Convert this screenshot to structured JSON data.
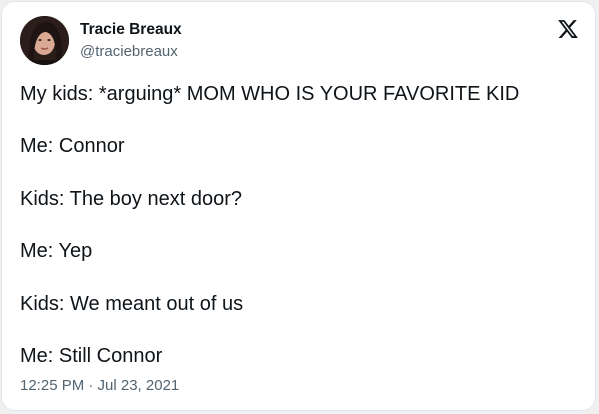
{
  "author": {
    "display_name": "Tracie Breaux",
    "handle": "@traciebreaux"
  },
  "tweet": {
    "lines": [
      "My kids: *arguing* MOM WHO IS YOUR FAVORITE KID",
      "Me: Connor",
      "Kids: The boy next door?",
      "Me: Yep",
      "Kids: We meant out of us",
      "Me: Still Connor"
    ],
    "timestamp": "12:25 PM · Jul 23, 2021"
  },
  "icons": {
    "platform_logo": "x-logo-icon",
    "avatar": "avatar"
  },
  "colors": {
    "text_primary": "#0f1419",
    "text_secondary": "#536471",
    "card_background": "#ffffff",
    "page_background": "#f0f0f0"
  }
}
